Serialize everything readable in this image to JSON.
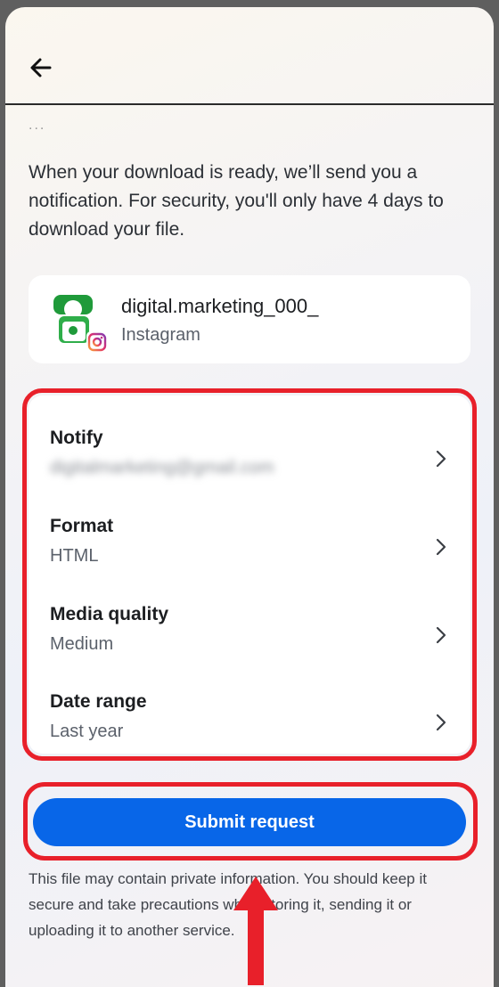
{
  "header": {
    "back_icon": "arrow-left-icon"
  },
  "cut_off_text": "...",
  "intro_text": "When your download is ready, we’ll send you a notification. For security, you'll only have 4 days to download your file.",
  "account": {
    "username": "digital.marketing_000_",
    "platform": "Instagram",
    "avatar_icon": "profile-avatar-icon",
    "badge_icon": "instagram-icon"
  },
  "settings": [
    {
      "title": "Notify",
      "value": "digitalmarketing@gmail.com"
    },
    {
      "title": "Format",
      "value": "HTML"
    },
    {
      "title": "Media quality",
      "value": "Medium"
    },
    {
      "title": "Date range",
      "value": "Last year"
    }
  ],
  "submit_label": "Submit request",
  "footnote": "This file may contain private information. You should keep it secure and take precautions when storing it, sending it or uploading it to another service.",
  "colors": {
    "accent": "#0866e8",
    "annotation": "#e8202a"
  }
}
